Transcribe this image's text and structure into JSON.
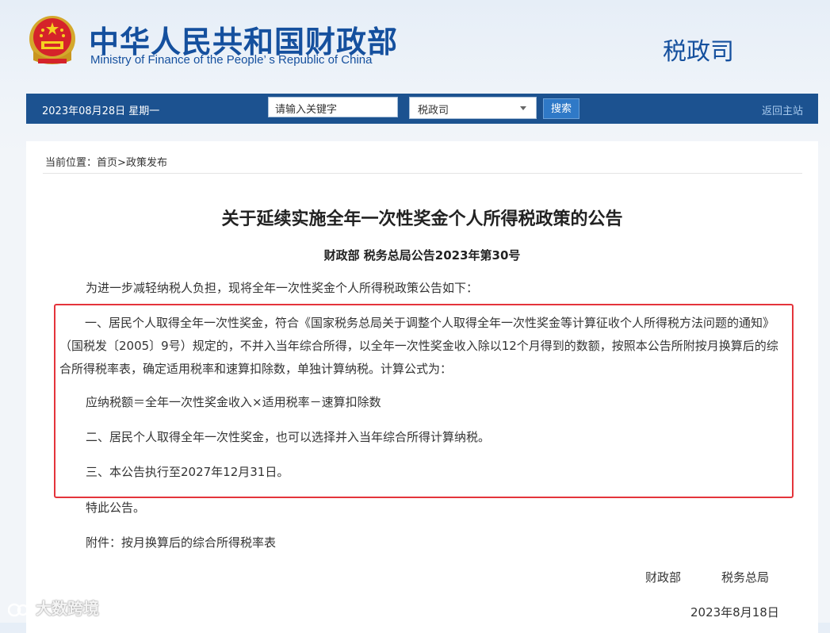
{
  "header": {
    "site_title_cn": "中华人民共和国财政部",
    "site_title_en": "Ministry of Finance of the People’ s Republic of China",
    "department": "税政司",
    "emblem_icon": "national-emblem-icon",
    "brand_color": "#15509e"
  },
  "navbar": {
    "date_text": "2023年08月28日  星期一",
    "search_placeholder": "请输入关键字",
    "scope_value": "税政司",
    "search_button": "搜索",
    "back_home": "返回主站",
    "bar_color": "#1c5290"
  },
  "breadcrumb": {
    "label": "当前位置：",
    "home": "首页",
    "separator": ">",
    "current": "政策发布"
  },
  "article": {
    "title": "关于延续实施全年一次性奖金个人所得税政策的公告",
    "doc_number": "财政部  税务总局公告2023年第30号",
    "intro": "为进一步减轻纳税人负担，现将全年一次性奖金个人所得税政策公告如下：",
    "item1": "一、居民个人取得全年一次性奖金，符合《国家税务总局关于调整个人取得全年一次性奖金等计算征收个人所得税方法问题的通知》（国税发〔2005〕9号）规定的，不并入当年综合所得，以全年一次性奖金收入除以12个月得到的数额，按照本公告所附按月换算后的综合所得税率表，确定适用税率和速算扣除数，单独计算纳税。计算公式为：",
    "formula": "应纳税额＝全年一次性奖金收入×适用税率－速算扣除数",
    "item2": "二、居民个人取得全年一次性奖金，也可以选择并入当年综合所得计算纳税。",
    "item3": "三、本公告执行至2027年12月31日。",
    "closing": "特此公告。",
    "attachment": "附件：按月换算后的综合所得税率表",
    "signature_1": "财政部",
    "signature_2": "税务总局",
    "date": "2023年8月18日"
  },
  "highlight_color": "#e4343b",
  "watermark": "大数跨境"
}
